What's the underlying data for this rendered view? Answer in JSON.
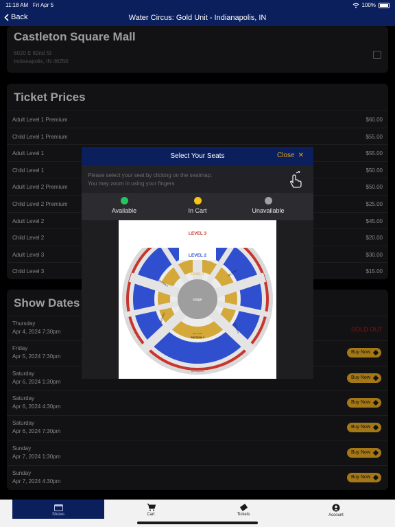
{
  "status": {
    "time": "11:18 AM",
    "date": "Fri Apr 5",
    "battery": "100%"
  },
  "nav": {
    "back": "Back",
    "title": "Water Circus: Gold Unit - Indianapolis, IN"
  },
  "venue": {
    "name": "Castleton Square Mall",
    "address1": "6020 E 82nd St",
    "address2": "Indianapolis, IN 46250"
  },
  "prices": {
    "title": "Ticket Prices",
    "items": [
      {
        "label": "Adult Level 1 Premium",
        "price": "$60.00"
      },
      {
        "label": "Child Level 1 Premium",
        "price": "$55.00"
      },
      {
        "label": "Adult Level 1",
        "price": "$55.00"
      },
      {
        "label": "Child Level 1",
        "price": "$50.00"
      },
      {
        "label": "Adult Level 2 Premium",
        "price": "$50.00"
      },
      {
        "label": "Child Level 2 Premium",
        "price": "$25.00"
      },
      {
        "label": "Adult Level 2",
        "price": "$45.00"
      },
      {
        "label": "Child Level 2",
        "price": "$20.00"
      },
      {
        "label": "Adult Level 3",
        "price": "$30.00"
      },
      {
        "label": "Child Level 3",
        "price": "$15.00"
      }
    ]
  },
  "dates": {
    "title": "Show Dates",
    "items": [
      {
        "day": "Thursday",
        "date": "Apr 4, 2024 7:30pm",
        "status": "SOLD OUT"
      },
      {
        "day": "Friday",
        "date": "Apr 5, 2024 7:30pm",
        "status": "Buy Now"
      },
      {
        "day": "Saturday",
        "date": "Apr 6, 2024 1:30pm",
        "status": "Buy Now"
      },
      {
        "day": "Saturday",
        "date": "Apr 6, 2024 4:30pm",
        "status": "Buy Now"
      },
      {
        "day": "Saturday",
        "date": "Apr 6, 2024 7:30pm",
        "status": "Buy Now"
      },
      {
        "day": "Sunday",
        "date": "Apr 7, 2024 1:30pm",
        "status": "Buy Now"
      },
      {
        "day": "Sunday",
        "date": "Apr 7, 2024 4:30pm",
        "status": "Buy Now"
      }
    ]
  },
  "modal": {
    "title": "Select Your Seats",
    "close": "Close",
    "info1": "Please select your seat by clicking on the seatmap.",
    "info2": "You may zoom in using your fingers",
    "legend": [
      {
        "label": "Available",
        "color": "#22c55e"
      },
      {
        "label": "In Cart",
        "color": "#f5c518"
      },
      {
        "label": "Unavailable",
        "color": "#a0a0a0"
      }
    ],
    "seatmap": {
      "level3": "LEVEL 3",
      "level2": "LEVEL 2",
      "level1": "LEVEL 1",
      "stage": "stage",
      "section1": "SECTION 1",
      "section2": "SECTION 2",
      "section3": "SECTION 3",
      "section4": "SECTION 4",
      "section5": "SECTION 5",
      "section6": "SECTION 6",
      "section7": "SECTION 7",
      "ring": "Ring Curtain",
      "backstage": "Back Stage/Out"
    }
  },
  "tabs": [
    {
      "label": "Shows",
      "icon": "calendar-icon"
    },
    {
      "label": "Cart",
      "icon": "cart-icon"
    },
    {
      "label": "Tickets",
      "icon": "ticket-icon"
    },
    {
      "label": "Account",
      "icon": "account-icon"
    }
  ]
}
